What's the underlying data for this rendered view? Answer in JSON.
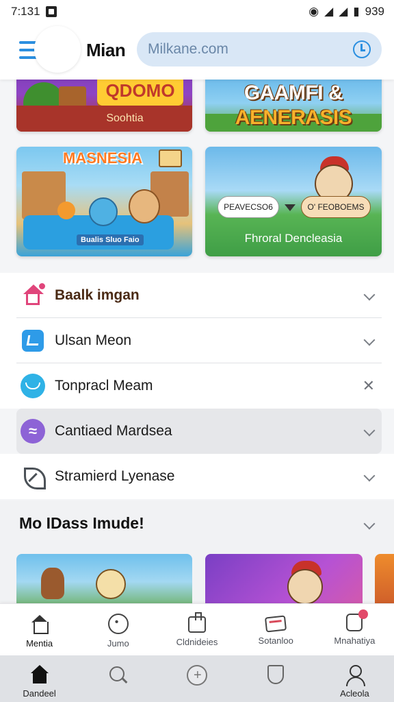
{
  "status_bar": {
    "time": "7:131",
    "battery": "939"
  },
  "header": {
    "title": "Mian",
    "url": "Milkane.com"
  },
  "cards": [
    {
      "banner": "QDOMO",
      "caption": "Soohtia"
    },
    {
      "title_line1": "GAAMFI &",
      "title_line2": "AENERASIS"
    },
    {
      "title": "MASNESIA",
      "caption": "Bualis Sluo Faio"
    },
    {
      "pill_a": "PEAVECSO6",
      "pill_b": "O' FEOBOEMS",
      "caption": "Fhroral Dencleasia"
    }
  ],
  "list": {
    "items": [
      {
        "label": "Baalk imgan",
        "icon": "house-icon",
        "trailing": "chevron"
      },
      {
        "label": "Ulsan Meon",
        "icon": "pencil-square-icon",
        "trailing": "chevron"
      },
      {
        "label": "Tonpracl Meam",
        "icon": "cloud-circle-icon",
        "trailing": "close"
      },
      {
        "label": "Cantiaed Mardsea",
        "icon": "waves-circle-icon",
        "trailing": "chevron"
      },
      {
        "label": "Stramierd Lyenase",
        "icon": "leaf-icon",
        "trailing": "chevron"
      }
    ]
  },
  "more": {
    "title": "Mo IDass Imude!"
  },
  "nav_top": {
    "items": [
      {
        "label": "Mentia",
        "icon": "home-icon"
      },
      {
        "label": "Jumo",
        "icon": "circle-icon"
      },
      {
        "label": "Cldnideies",
        "icon": "box-icon"
      },
      {
        "label": "Sotanloo",
        "icon": "card-icon"
      },
      {
        "label": "Mnahatiya",
        "icon": "bell-icon"
      }
    ]
  },
  "nav_bottom": {
    "items": [
      {
        "label": "Dandeel",
        "icon": "home-filled-icon"
      },
      {
        "label": "",
        "icon": "search-icon"
      },
      {
        "label": "",
        "icon": "plus-circle-icon"
      },
      {
        "label": "",
        "icon": "shield-icon"
      },
      {
        "label": "Acleola",
        "icon": "user-icon"
      }
    ]
  },
  "colors": {
    "accent": "#2b8fe0",
    "url_bar_bg": "#d9e7f6",
    "highlight_row": "#e6e7ea",
    "badge": "#e24a6a"
  }
}
